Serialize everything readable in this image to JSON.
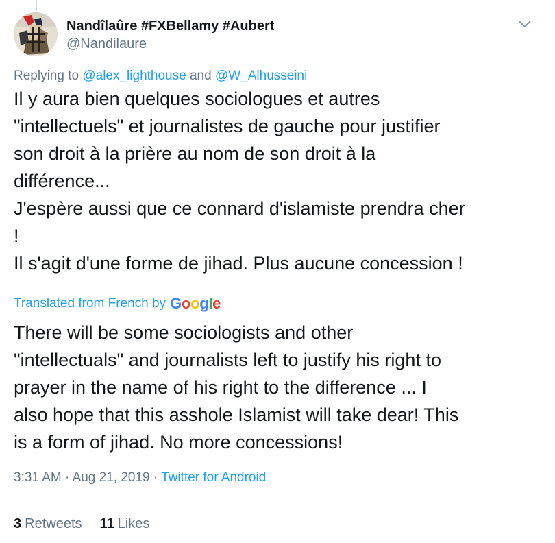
{
  "tweet": {
    "author": {
      "display_name": "Nandîlaûre #FXBellamy #Aubert",
      "handle": "@Nandilaure"
    },
    "replying": {
      "prefix": "Replying to",
      "mention_1": "@alex_lighthouse",
      "connector": "and",
      "mention_2": "@W_Alhusseini"
    },
    "text_lines": [
      "Il y aura bien quelques sociologues et autres",
      "\"intellectuels\" et  journalistes de gauche pour justifier",
      "son droit à la prière au nom de son droit à la",
      "différence...",
      "J'espère aussi que ce connard d'islamiste prendra cher",
      "!",
      "Il s'agit d'une forme de jihad. Plus aucune concession !"
    ],
    "translation": {
      "label": "Translated from French by",
      "provider": "Google",
      "provider_letters": [
        "G",
        "o",
        "o",
        "g",
        "l",
        "e"
      ],
      "lines": [
        "There will be some sociologists and other",
        "\"intellectuals\" and journalists left to justify his right to",
        "prayer in the name of his right to the difference ... I",
        "also hope that this asshole Islamist will take dear! This",
        "is a form of jihad. No more concessions!"
      ]
    },
    "meta": {
      "time": "3:31 AM",
      "separator": "·",
      "date": "Aug 21, 2019",
      "separator_2": "·",
      "source": "Twitter for Android"
    },
    "stats": {
      "retweets_count": "3",
      "retweets_label": "Retweets",
      "likes_count": "11",
      "likes_label": "Likes"
    }
  },
  "icons": {
    "avatar": "avatar-image",
    "menu": "chevron-down-icon"
  },
  "colors": {
    "link": "#1da1f2",
    "secondary_text": "#657786",
    "primary_text": "#14171a",
    "divider": "#e1e8ed"
  }
}
